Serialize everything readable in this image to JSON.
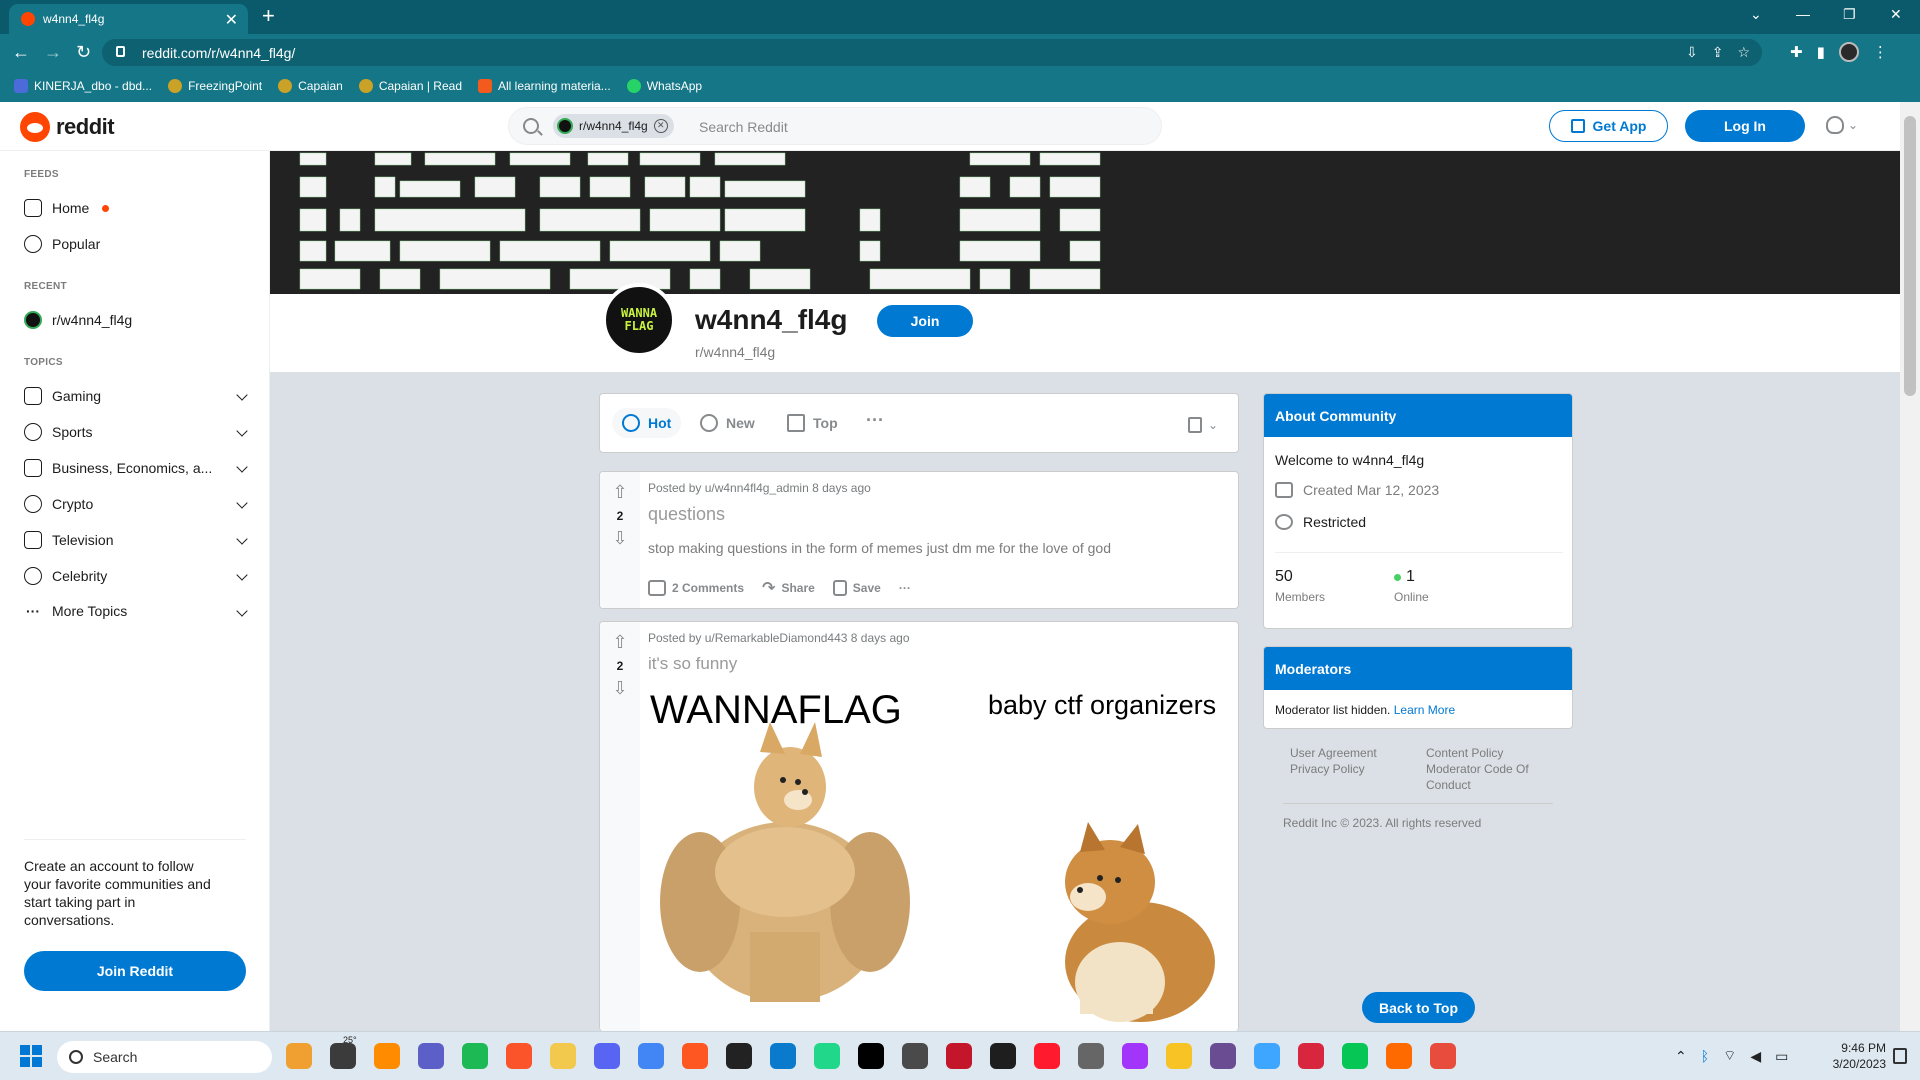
{
  "browser": {
    "tab_title": "w4nn4_fl4g",
    "tab_close": "✕",
    "new_tab": "+",
    "url": "reddit.com/r/w4nn4_fl4g/",
    "bookmarks": [
      {
        "label": "KINERJA_dbo - dbd...",
        "color": "#4a6bd8"
      },
      {
        "label": "FreezingPoint",
        "color": "#c9a227"
      },
      {
        "label": "Capaian",
        "color": "#c9a227"
      },
      {
        "label": "Capaian | Read",
        "color": "#c9a227"
      },
      {
        "label": "All learning materia...",
        "color": "#f35a1d"
      },
      {
        "label": "WhatsApp",
        "color": "#25d366"
      }
    ]
  },
  "header": {
    "logo_text": "reddit",
    "search_chip": "r/w4nn4_fl4g",
    "search_placeholder": "Search Reddit",
    "get_app": "Get App",
    "login": "Log In"
  },
  "sidebar": {
    "feeds_label": "FEEDS",
    "feeds": [
      "Home",
      "Popular"
    ],
    "recent_label": "RECENT",
    "recent": [
      "r/w4nn4_fl4g"
    ],
    "topics_label": "TOPICS",
    "topics": [
      "Gaming",
      "Sports",
      "Business, Economics, a...",
      "Crypto",
      "Television",
      "Celebrity",
      "More Topics"
    ],
    "create_text": "Create an account to follow your favorite communities and start taking part in conversations.",
    "join_reddit": "Join Reddit"
  },
  "subreddit": {
    "icon_text_1": "WANNA",
    "icon_text_2": "FLAG",
    "title": "w4nn4_fl4g",
    "name": "r/w4nn4_fl4g",
    "join": "Join"
  },
  "sortbar": {
    "hot": "Hot",
    "new": "New",
    "top": "Top",
    "more": "···"
  },
  "posts": [
    {
      "meta": "Posted by u/w4nn4fl4g_admin 8 days ago",
      "score": "2",
      "title": "questions",
      "body": "stop making questions in the form of memes just dm me for the love of god",
      "comments": "2 Comments",
      "share": "Share",
      "save": "Save",
      "more": "···"
    },
    {
      "meta": "Posted by u/RemarkableDiamond443 8 days ago",
      "score": "2",
      "title": "it's so funny",
      "meme_left": "WANNAFLAG",
      "meme_right": "baby ctf organizers"
    }
  ],
  "about": {
    "head": "About Community",
    "welcome": "Welcome to w4nn4_fl4g",
    "created": "Created Mar 12, 2023",
    "restricted": "Restricted",
    "members_num": "50",
    "members_label": "Members",
    "online_num": "1",
    "online_label": "Online"
  },
  "moderators": {
    "head": "Moderators",
    "text": "Moderator list hidden.",
    "learn_more": "Learn More"
  },
  "footer": {
    "user_agreement": "User Agreement",
    "privacy_policy": "Privacy Policy",
    "content_policy": "Content Policy",
    "moderator_code_1": "Moderator Code Of",
    "moderator_code_2": "Conduct",
    "copyright": "Reddit Inc © 2023. All rights reserved"
  },
  "back_to_top": "Back to Top",
  "taskbar": {
    "search": "Search",
    "weather": "25°",
    "time": "9:46 PM",
    "date": "3/20/2023",
    "app_colors": [
      "#f0a030",
      "#3b3b3b",
      "#ff8c00",
      "#5b5fc7",
      "#1db954",
      "#fb542b",
      "#f2c94c",
      "#5865f2",
      "#4285f4",
      "#ff5722",
      "#222222",
      "#0a7acc",
      "#21d789",
      "#000000",
      "#4a4a4a",
      "#c4162a",
      "#1e1e1e",
      "#ff1b2d",
      "#666666",
      "#a334fa",
      "#f7c325",
      "#6a4c93",
      "#3ea6ff",
      "#d7263d",
      "#06c755",
      "#ff6a00",
      "#e74c3c"
    ]
  },
  "colors": {
    "brand": "#ff4500",
    "accent": "#0079d3",
    "chrome": "#147686"
  }
}
